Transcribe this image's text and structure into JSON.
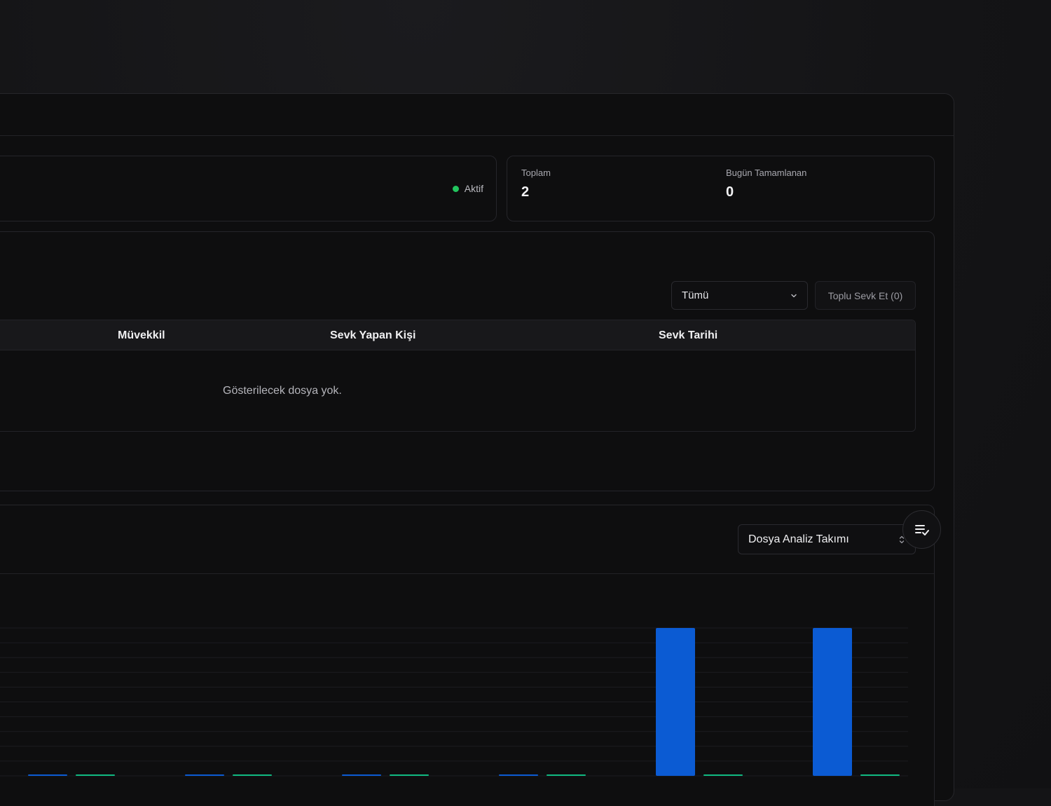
{
  "status": {
    "label": "Aktif",
    "color": "#22c55e"
  },
  "stats": [
    {
      "label": "Toplam",
      "value": "2"
    },
    {
      "label": "Bugün Tamamlanan",
      "value": "0"
    }
  ],
  "filters": {
    "select_value": "Tümü",
    "bulk_button": "Toplu Sevk Et (0)"
  },
  "table": {
    "columns": [
      "Müvekkil",
      "Sevk Yapan Kişi",
      "Sevk Tarihi"
    ],
    "empty_message": "Gösterilecek dosya yok."
  },
  "team_select": {
    "value": "Dosya Analiz Takımı"
  },
  "icons": {
    "fab": "list-check-icon",
    "select": "chevron-down-icon",
    "team_select": "chevron-up-down-icon"
  },
  "chart_data": {
    "type": "bar",
    "categories": [
      "",
      "",
      "",
      "",
      "",
      ""
    ],
    "ylim": [
      0,
      1
    ],
    "series": [
      {
        "color": "#0b5bd3",
        "values": [
          0,
          0,
          0,
          0,
          1,
          1
        ]
      },
      {
        "color": "#10b981",
        "values": [
          0,
          0,
          0,
          0,
          0,
          0
        ]
      }
    ],
    "grid": true
  }
}
